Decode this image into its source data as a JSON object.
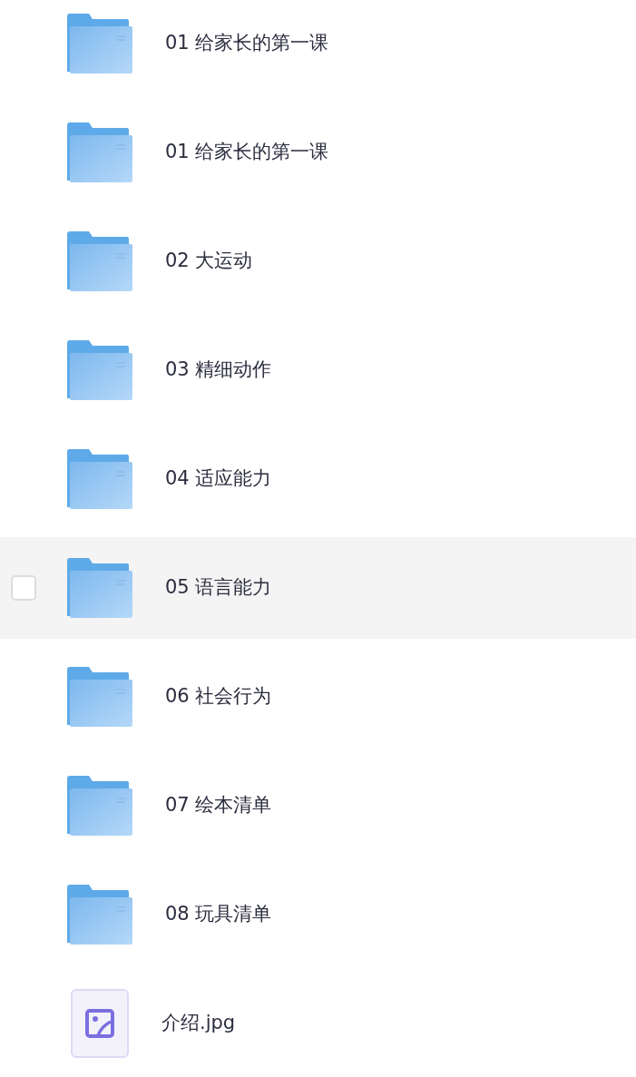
{
  "files": [
    {
      "kind": "folder",
      "name": "01 给家长的第一课"
    },
    {
      "kind": "folder",
      "name": "01 给家长的第一课"
    },
    {
      "kind": "folder",
      "name": "02 大运动"
    },
    {
      "kind": "folder",
      "name": "03 精细动作"
    },
    {
      "kind": "folder",
      "name": "04 适应能力"
    },
    {
      "kind": "folder",
      "name": "05 语言能力",
      "highlighted": true,
      "checkbox": {
        "checked": false
      }
    },
    {
      "kind": "folder",
      "name": "06 社会行为"
    },
    {
      "kind": "folder",
      "name": "07 绘本清单"
    },
    {
      "kind": "folder",
      "name": "08 玩具清单"
    },
    {
      "kind": "image",
      "name": "介绍.jpg"
    }
  ]
}
